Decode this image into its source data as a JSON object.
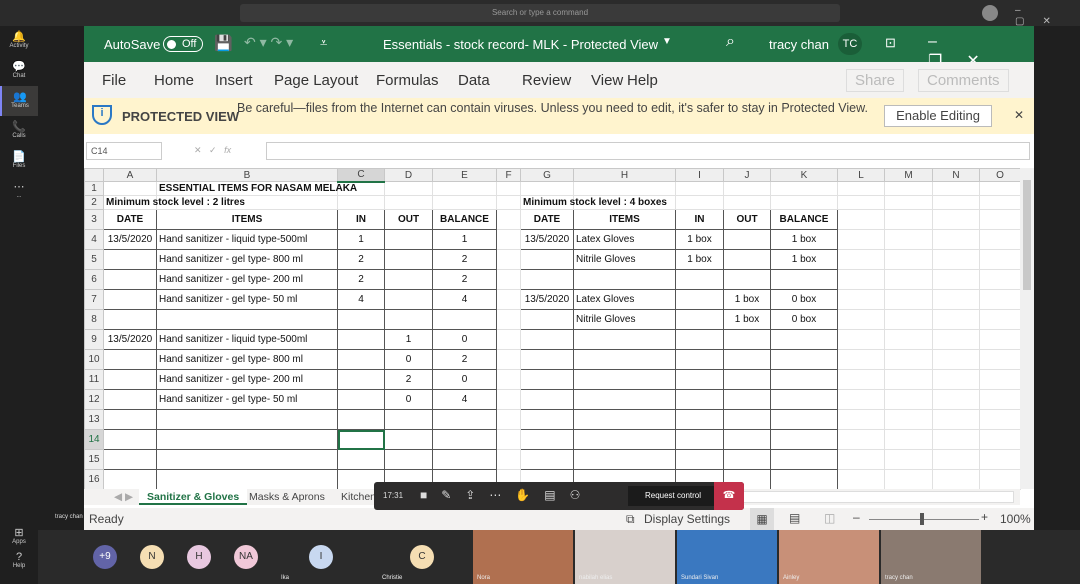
{
  "teams": {
    "search_placeholder": "Search or type a command",
    "rail": [
      {
        "label": "Activity",
        "icon": "bell-icon",
        "g": "🔔"
      },
      {
        "label": "Chat",
        "icon": "chat-icon",
        "g": "💬",
        "badge": "4"
      },
      {
        "label": "Teams",
        "icon": "teams-icon",
        "g": "👥",
        "active": true
      },
      {
        "label": "Calls",
        "icon": "phone-icon",
        "g": "📞"
      },
      {
        "label": "Files",
        "icon": "file-icon",
        "g": "📄"
      },
      {
        "label": "...",
        "icon": "more-icon",
        "g": "⋯"
      }
    ],
    "apps": "Apps",
    "help": "Help",
    "presenter": "tracy chan"
  },
  "excel": {
    "autosave": "AutoSave",
    "autosave_state": "Off",
    "title": "Essentials - stock record- MLK  -  Protected View",
    "user": "tracy chan",
    "user_initials": "TC",
    "menu": [
      "File",
      "Home",
      "Insert",
      "Page Layout",
      "Formulas",
      "Data",
      "Review",
      "View",
      "Help"
    ],
    "share": "Share",
    "comments": "Comments",
    "protected": {
      "label": "PROTECTED VIEW",
      "message": "Be careful—files from the Internet can contain viruses. Unless you need to edit, it's safer to stay in Protected View.",
      "button": "Enable Editing"
    },
    "name_box": "C14",
    "columns": [
      "A",
      "B",
      "C",
      "D",
      "E",
      "F",
      "G",
      "H",
      "I",
      "J",
      "K",
      "L",
      "M",
      "N",
      "O"
    ],
    "rows": [
      [
        "",
        "ESSENTIAL ITEMS FOR NASAM MELAKA",
        "",
        "",
        "",
        "",
        "",
        "",
        "",
        "",
        "",
        "",
        "",
        "",
        ""
      ],
      [
        "Minimum stock level  : 2 litres",
        "",
        "",
        "",
        "",
        "",
        "Minimum stock level :  4 boxes",
        "",
        "",
        "",
        "",
        "",
        "",
        "",
        ""
      ],
      [
        "DATE",
        "ITEMS",
        "IN",
        "OUT",
        "BALANCE",
        "",
        "DATE",
        "ITEMS",
        "IN",
        "OUT",
        "BALANCE",
        "",
        "",
        "",
        ""
      ],
      [
        "13/5/2020",
        "Hand sanitizer - liquid type-500ml",
        "1",
        "",
        "1",
        "",
        "13/5/2020",
        "Latex Gloves",
        "1 box",
        "",
        "1 box",
        "",
        "",
        "",
        ""
      ],
      [
        "",
        "Hand sanitizer - gel type- 800 ml",
        "2",
        "",
        "2",
        "",
        "",
        "Nitrile Gloves",
        "1 box",
        "",
        "1 box",
        "",
        "",
        "",
        ""
      ],
      [
        "",
        "Hand sanitizer - gel type- 200 ml",
        "2",
        "",
        "2",
        "",
        "",
        "",
        "",
        "",
        "",
        "",
        "",
        "",
        ""
      ],
      [
        "",
        "Hand sanitizer - gel type- 50 ml",
        "4",
        "",
        "4",
        "",
        "13/5/2020",
        "Latex Gloves",
        "",
        "1 box",
        "0 box",
        "",
        "",
        "",
        ""
      ],
      [
        "",
        "",
        "",
        "",
        "",
        "",
        "",
        "Nitrile Gloves",
        "",
        "1 box",
        "0 box",
        "",
        "",
        "",
        ""
      ],
      [
        "13/5/2020",
        "Hand sanitizer - liquid type-500ml",
        "",
        "1",
        "0",
        "",
        "",
        "",
        "",
        "",
        "",
        "",
        "",
        "",
        ""
      ],
      [
        "",
        "Hand sanitizer - gel type- 800 ml",
        "",
        "0",
        "2",
        "",
        "",
        "",
        "",
        "",
        "",
        "",
        "",
        "",
        ""
      ],
      [
        "",
        "Hand sanitizer - gel type- 200 ml",
        "",
        "2",
        "0",
        "",
        "",
        "",
        "",
        "",
        "",
        "",
        "",
        "",
        ""
      ],
      [
        "",
        "Hand sanitizer - gel type- 50 ml",
        "",
        "0",
        "4",
        "",
        "",
        "",
        "",
        "",
        "",
        "",
        "",
        "",
        ""
      ],
      [
        "",
        "",
        "",
        "",
        "",
        "",
        "",
        "",
        "",
        "",
        "",
        "",
        "",
        "",
        ""
      ],
      [
        "",
        "",
        "",
        "",
        "",
        "",
        "",
        "",
        "",
        "",
        "",
        "",
        "",
        "",
        ""
      ],
      [
        "",
        "",
        "",
        "",
        "",
        "",
        "",
        "",
        "",
        "",
        "",
        "",
        "",
        "",
        ""
      ],
      [
        "",
        "",
        "",
        "",
        "",
        "",
        "",
        "",
        "",
        "",
        "",
        "",
        "",
        "",
        ""
      ]
    ],
    "sheets": [
      "Sanitizer & Gloves",
      "Masks & Aprons",
      "Kitchen"
    ],
    "status": "Ready",
    "display_settings": "Display Settings",
    "zoom": "100%"
  },
  "meeting": {
    "time": "17:31",
    "request_control": "Request control",
    "participants": [
      {
        "i": "+9",
        "c": "#6264a7"
      },
      {
        "i": "N",
        "c": "#f5deb3"
      },
      {
        "i": "H",
        "c": "#e8c8e0"
      },
      {
        "i": "NA",
        "c": "#f0c8d8"
      },
      {
        "i": "I",
        "c": "#c8d8f0",
        "name": "Ika"
      },
      {
        "i": "C",
        "c": "#f5deb3",
        "name": "Christie"
      }
    ],
    "videos": [
      "Nora",
      "nabilah elias",
      "Sundari Sivan",
      "Ainley",
      "tracy chan"
    ]
  },
  "colors": {
    "excel_green": "#217346",
    "protected_yellow": "#fff4ce",
    "hangup": "#c4314b"
  }
}
